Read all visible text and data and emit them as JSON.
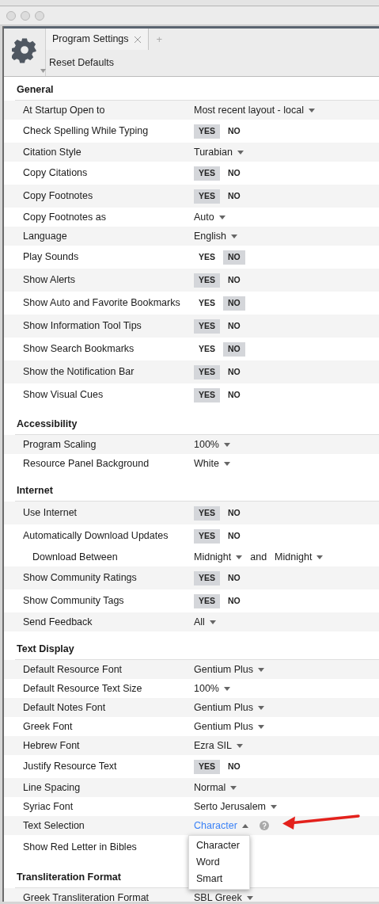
{
  "tabs": [
    {
      "label": "Program Settings",
      "selected": true
    }
  ],
  "new_tab": "+",
  "toolbar": {
    "action": "Reset Defaults"
  },
  "sections": [
    {
      "title": "General",
      "rows": [
        {
          "label": "At Startup Open to",
          "kind": "dropdown",
          "value": "Most recent layout - local"
        },
        {
          "label": "Check Spelling While Typing",
          "kind": "toggle",
          "options": [
            {
              "label": "YES",
              "selected": true
            },
            {
              "label": "NO",
              "selected": false
            }
          ]
        },
        {
          "label": "Citation Style",
          "kind": "dropdown",
          "value": "Turabian"
        },
        {
          "label": "Copy Citations",
          "kind": "toggle",
          "options": [
            {
              "label": "YES",
              "selected": true
            },
            {
              "label": "NO",
              "selected": false
            }
          ]
        },
        {
          "label": "Copy Footnotes",
          "kind": "toggle",
          "options": [
            {
              "label": "YES",
              "selected": true
            },
            {
              "label": "NO",
              "selected": false
            }
          ]
        },
        {
          "label": "Copy Footnotes as",
          "kind": "dropdown",
          "value": "Auto"
        },
        {
          "label": "Language",
          "kind": "dropdown",
          "value": "English"
        },
        {
          "label": "Play Sounds",
          "kind": "toggle",
          "options": [
            {
              "label": "YES",
              "selected": false
            },
            {
              "label": "NO",
              "selected": true
            }
          ]
        },
        {
          "label": "Show Alerts",
          "kind": "toggle",
          "options": [
            {
              "label": "YES",
              "selected": true
            },
            {
              "label": "NO",
              "selected": false
            }
          ]
        },
        {
          "label": "Show Auto and Favorite Bookmarks",
          "kind": "toggle",
          "options": [
            {
              "label": "YES",
              "selected": false
            },
            {
              "label": "NO",
              "selected": true
            }
          ]
        },
        {
          "label": "Show Information Tool Tips",
          "kind": "toggle",
          "options": [
            {
              "label": "YES",
              "selected": true
            },
            {
              "label": "NO",
              "selected": false
            }
          ]
        },
        {
          "label": "Show Search Bookmarks",
          "kind": "toggle",
          "options": [
            {
              "label": "YES",
              "selected": false
            },
            {
              "label": "NO",
              "selected": true
            }
          ]
        },
        {
          "label": "Show the Notification Bar",
          "kind": "toggle",
          "options": [
            {
              "label": "YES",
              "selected": true
            },
            {
              "label": "NO",
              "selected": false
            }
          ]
        },
        {
          "label": "Show Visual Cues",
          "kind": "toggle",
          "options": [
            {
              "label": "YES",
              "selected": true
            },
            {
              "label": "NO",
              "selected": false
            }
          ]
        }
      ]
    },
    {
      "title": "Accessibility",
      "rows": [
        {
          "label": "Program Scaling",
          "kind": "dropdown",
          "value": "100%"
        },
        {
          "label": "Resource Panel Background",
          "kind": "dropdown",
          "value": "White"
        }
      ]
    },
    {
      "title": "Internet",
      "rows": [
        {
          "label": "Use Internet",
          "kind": "toggle",
          "options": [
            {
              "label": "YES",
              "selected": true
            },
            {
              "label": "NO",
              "selected": false
            }
          ]
        },
        {
          "label": "Automatically Download Updates",
          "kind": "toggle",
          "options": [
            {
              "label": "YES",
              "selected": true
            },
            {
              "label": "NO",
              "selected": false
            }
          ],
          "children": [
            {
              "label": "Download Between",
              "kind": "range",
              "from": "Midnight",
              "joiner": "and",
              "to": "Midnight"
            }
          ]
        },
        {
          "label": "Show Community Ratings",
          "kind": "toggle",
          "options": [
            {
              "label": "YES",
              "selected": true
            },
            {
              "label": "NO",
              "selected": false
            }
          ]
        },
        {
          "label": "Show Community Tags",
          "kind": "toggle",
          "options": [
            {
              "label": "YES",
              "selected": true
            },
            {
              "label": "NO",
              "selected": false
            }
          ]
        },
        {
          "label": "Send Feedback",
          "kind": "dropdown",
          "value": "All"
        }
      ]
    },
    {
      "title": "Text Display",
      "rows": [
        {
          "label": "Default Resource Font",
          "kind": "dropdown",
          "value": "Gentium Plus"
        },
        {
          "label": "Default Resource Text Size",
          "kind": "dropdown",
          "value": "100%"
        },
        {
          "label": "Default Notes Font",
          "kind": "dropdown",
          "value": "Gentium Plus"
        },
        {
          "label": "Greek Font",
          "kind": "dropdown",
          "value": "Gentium Plus"
        },
        {
          "label": "Hebrew Font",
          "kind": "dropdown",
          "value": "Ezra SIL"
        },
        {
          "label": "Justify Resource Text",
          "kind": "toggle",
          "options": [
            {
              "label": "YES",
              "selected": true
            },
            {
              "label": "NO",
              "selected": false
            }
          ]
        },
        {
          "label": "Line Spacing",
          "kind": "dropdown",
          "value": "Normal"
        },
        {
          "label": "Syriac Font",
          "kind": "dropdown",
          "value": "Serto Jerusalem"
        },
        {
          "label": "Text Selection",
          "kind": "dropdown",
          "value": "Character",
          "expanded": true,
          "help": true,
          "menu": [
            "Character",
            "Word",
            "Smart"
          ]
        },
        {
          "label": "Show Red Letter in Bibles",
          "kind": "plain"
        }
      ]
    },
    {
      "title": "Transliteration Format",
      "rows": [
        {
          "label": "Greek Transliteration Format",
          "kind": "dropdown",
          "value": "SBL Greek"
        }
      ]
    }
  ]
}
